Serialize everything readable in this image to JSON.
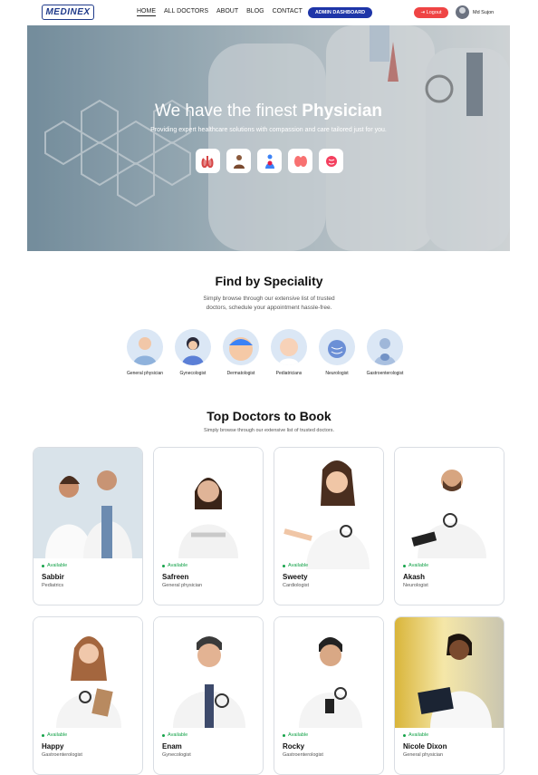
{
  "nav": {
    "logo": "MEDINEX",
    "links": [
      "HOME",
      "ALL DOCTORS",
      "ABOUT",
      "BLOG",
      "CONTACT"
    ],
    "admin": "ADMIN DASHBOARD",
    "logout": "Logout",
    "user": "Md Sujon"
  },
  "hero": {
    "title_a": "We have the finest ",
    "title_b": "Physician",
    "subtitle": "Providing expert healthcare solutions with compassion and care tailored just for you."
  },
  "speciality": {
    "title": "Find by Speciality",
    "subtitle_1": "Simply browse through our extensive list of trusted",
    "subtitle_2": "doctors, schedule your appointment hassle-free.",
    "items": [
      "General physician",
      "Gynecologist",
      "Dermatologist",
      "Pediatricians",
      "Neurologist",
      "Gastroenterologist"
    ]
  },
  "top": {
    "title": "Top Doctors to Book",
    "subtitle": "Simply browse through our extensive list of trusted doctors.",
    "doctors": [
      {
        "status": "Available",
        "name": "Sabbir",
        "spec": "Pediatrics"
      },
      {
        "status": "Available",
        "name": "Safreen",
        "spec": "General physician"
      },
      {
        "status": "Available",
        "name": "Sweety",
        "spec": "Cardiologist"
      },
      {
        "status": "Available",
        "name": "Akash",
        "spec": "Neurologist"
      },
      {
        "status": "Available",
        "name": "Happy",
        "spec": "Gastroenterologist"
      },
      {
        "status": "Available",
        "name": "Enam",
        "spec": "Gynecologist"
      },
      {
        "status": "Available",
        "name": "Rocky",
        "spec": "Gastroenterologist"
      },
      {
        "status": "Available",
        "name": "Nicole Dixon",
        "spec": "General physician"
      }
    ]
  },
  "colors": {
    "primary": "#1e35a8",
    "logout": "#ef4444",
    "available": "#16a34a"
  }
}
